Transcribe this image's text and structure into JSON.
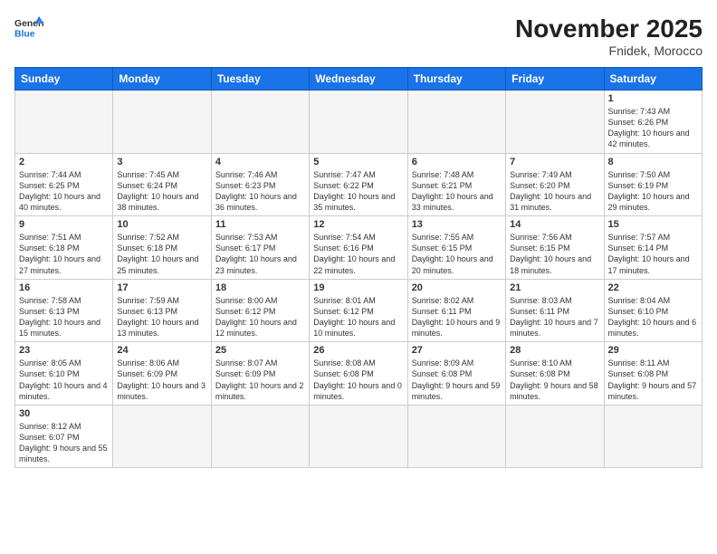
{
  "logo": {
    "general": "General",
    "blue": "Blue"
  },
  "title": "November 2025",
  "subtitle": "Fnidek, Morocco",
  "days": [
    "Sunday",
    "Monday",
    "Tuesday",
    "Wednesday",
    "Thursday",
    "Friday",
    "Saturday"
  ],
  "rows": [
    [
      {
        "num": "",
        "text": ""
      },
      {
        "num": "",
        "text": ""
      },
      {
        "num": "",
        "text": ""
      },
      {
        "num": "",
        "text": ""
      },
      {
        "num": "",
        "text": ""
      },
      {
        "num": "",
        "text": ""
      },
      {
        "num": "1",
        "text": "Sunrise: 7:43 AM\nSunset: 6:26 PM\nDaylight: 10 hours and 42 minutes."
      }
    ],
    [
      {
        "num": "2",
        "text": "Sunrise: 7:44 AM\nSunset: 6:25 PM\nDaylight: 10 hours and 40 minutes."
      },
      {
        "num": "3",
        "text": "Sunrise: 7:45 AM\nSunset: 6:24 PM\nDaylight: 10 hours and 38 minutes."
      },
      {
        "num": "4",
        "text": "Sunrise: 7:46 AM\nSunset: 6:23 PM\nDaylight: 10 hours and 36 minutes."
      },
      {
        "num": "5",
        "text": "Sunrise: 7:47 AM\nSunset: 6:22 PM\nDaylight: 10 hours and 35 minutes."
      },
      {
        "num": "6",
        "text": "Sunrise: 7:48 AM\nSunset: 6:21 PM\nDaylight: 10 hours and 33 minutes."
      },
      {
        "num": "7",
        "text": "Sunrise: 7:49 AM\nSunset: 6:20 PM\nDaylight: 10 hours and 31 minutes."
      },
      {
        "num": "8",
        "text": "Sunrise: 7:50 AM\nSunset: 6:19 PM\nDaylight: 10 hours and 29 minutes."
      }
    ],
    [
      {
        "num": "9",
        "text": "Sunrise: 7:51 AM\nSunset: 6:18 PM\nDaylight: 10 hours and 27 minutes."
      },
      {
        "num": "10",
        "text": "Sunrise: 7:52 AM\nSunset: 6:18 PM\nDaylight: 10 hours and 25 minutes."
      },
      {
        "num": "11",
        "text": "Sunrise: 7:53 AM\nSunset: 6:17 PM\nDaylight: 10 hours and 23 minutes."
      },
      {
        "num": "12",
        "text": "Sunrise: 7:54 AM\nSunset: 6:16 PM\nDaylight: 10 hours and 22 minutes."
      },
      {
        "num": "13",
        "text": "Sunrise: 7:55 AM\nSunset: 6:15 PM\nDaylight: 10 hours and 20 minutes."
      },
      {
        "num": "14",
        "text": "Sunrise: 7:56 AM\nSunset: 6:15 PM\nDaylight: 10 hours and 18 minutes."
      },
      {
        "num": "15",
        "text": "Sunrise: 7:57 AM\nSunset: 6:14 PM\nDaylight: 10 hours and 17 minutes."
      }
    ],
    [
      {
        "num": "16",
        "text": "Sunrise: 7:58 AM\nSunset: 6:13 PM\nDaylight: 10 hours and 15 minutes."
      },
      {
        "num": "17",
        "text": "Sunrise: 7:59 AM\nSunset: 6:13 PM\nDaylight: 10 hours and 13 minutes."
      },
      {
        "num": "18",
        "text": "Sunrise: 8:00 AM\nSunset: 6:12 PM\nDaylight: 10 hours and 12 minutes."
      },
      {
        "num": "19",
        "text": "Sunrise: 8:01 AM\nSunset: 6:12 PM\nDaylight: 10 hours and 10 minutes."
      },
      {
        "num": "20",
        "text": "Sunrise: 8:02 AM\nSunset: 6:11 PM\nDaylight: 10 hours and 9 minutes."
      },
      {
        "num": "21",
        "text": "Sunrise: 8:03 AM\nSunset: 6:11 PM\nDaylight: 10 hours and 7 minutes."
      },
      {
        "num": "22",
        "text": "Sunrise: 8:04 AM\nSunset: 6:10 PM\nDaylight: 10 hours and 6 minutes."
      }
    ],
    [
      {
        "num": "23",
        "text": "Sunrise: 8:05 AM\nSunset: 6:10 PM\nDaylight: 10 hours and 4 minutes."
      },
      {
        "num": "24",
        "text": "Sunrise: 8:06 AM\nSunset: 6:09 PM\nDaylight: 10 hours and 3 minutes."
      },
      {
        "num": "25",
        "text": "Sunrise: 8:07 AM\nSunset: 6:09 PM\nDaylight: 10 hours and 2 minutes."
      },
      {
        "num": "26",
        "text": "Sunrise: 8:08 AM\nSunset: 6:08 PM\nDaylight: 10 hours and 0 minutes."
      },
      {
        "num": "27",
        "text": "Sunrise: 8:09 AM\nSunset: 6:08 PM\nDaylight: 9 hours and 59 minutes."
      },
      {
        "num": "28",
        "text": "Sunrise: 8:10 AM\nSunset: 6:08 PM\nDaylight: 9 hours and 58 minutes."
      },
      {
        "num": "29",
        "text": "Sunrise: 8:11 AM\nSunset: 6:08 PM\nDaylight: 9 hours and 57 minutes."
      }
    ],
    [
      {
        "num": "30",
        "text": "Sunrise: 8:12 AM\nSunset: 6:07 PM\nDaylight: 9 hours and 55 minutes."
      },
      {
        "num": "",
        "text": ""
      },
      {
        "num": "",
        "text": ""
      },
      {
        "num": "",
        "text": ""
      },
      {
        "num": "",
        "text": ""
      },
      {
        "num": "",
        "text": ""
      },
      {
        "num": "",
        "text": ""
      }
    ]
  ]
}
